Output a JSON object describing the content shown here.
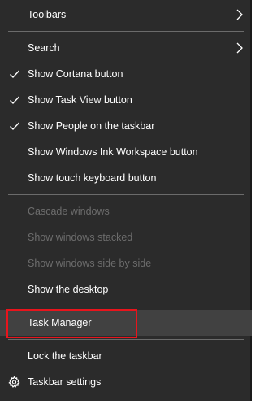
{
  "menu": {
    "items": [
      {
        "label": "Toolbars",
        "submenu": true
      },
      {
        "label": "Search",
        "submenu": true
      },
      {
        "label": "Show Cortana button",
        "checked": true
      },
      {
        "label": "Show Task View button",
        "checked": true
      },
      {
        "label": "Show People on the taskbar",
        "checked": true
      },
      {
        "label": "Show Windows Ink Workspace button"
      },
      {
        "label": "Show touch keyboard button"
      },
      {
        "label": "Cascade windows",
        "disabled": true
      },
      {
        "label": "Show windows stacked",
        "disabled": true
      },
      {
        "label": "Show windows side by side",
        "disabled": true
      },
      {
        "label": "Show the desktop"
      },
      {
        "label": "Task Manager",
        "hovered": true,
        "highlighted_red": true
      },
      {
        "label": "Lock the taskbar"
      },
      {
        "label": "Taskbar settings",
        "icon": "gear-icon"
      }
    ]
  },
  "colors": {
    "menu_background": "#2b2b2b",
    "hover_background": "#414141",
    "disabled_text": "#6d6d6d",
    "highlight_border": "#e8141c"
  }
}
